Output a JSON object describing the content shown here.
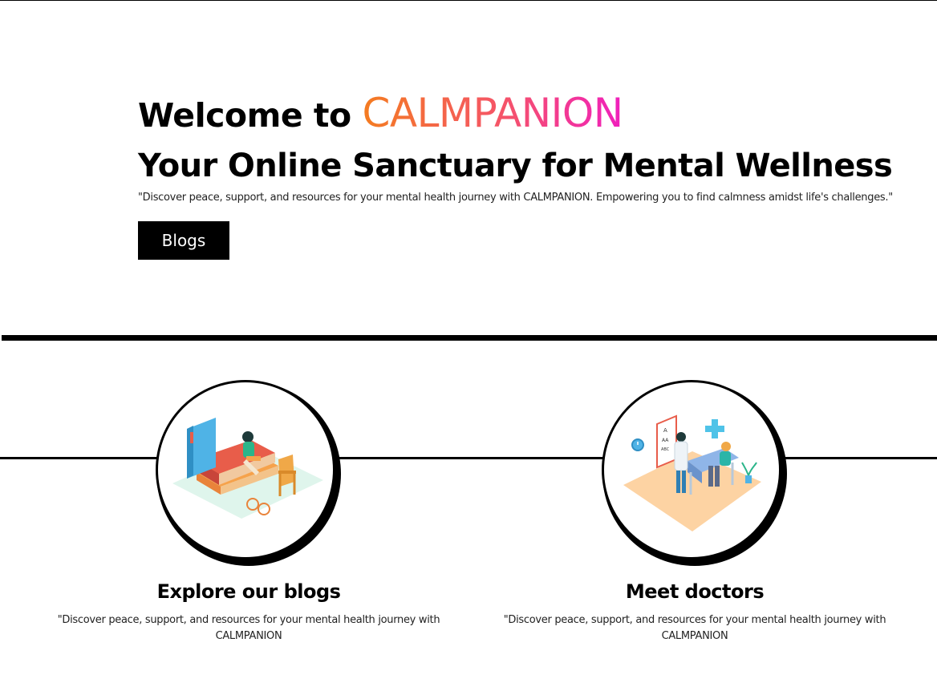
{
  "hero": {
    "welcome_prefix": "Welcome to ",
    "brand": "CALMPANION",
    "subtitle": "Your Online Sanctuary for Mental Wellness",
    "description": "\"Discover peace, support, and resources for your mental health journey with CALMPANION. Empowering you to find calmness amidst life's challenges.\"",
    "button_label": "Blogs"
  },
  "colors": {
    "brand_gradient": [
      "#f47c20",
      "#f5536a",
      "#f01fbd"
    ],
    "button_bg": "#000000",
    "button_text": "#ffffff"
  },
  "features": [
    {
      "icon": "reading-illustration-icon",
      "title": "Explore our blogs",
      "description": "\"Discover peace, support, and resources for your mental health journey with CALMPANION"
    },
    {
      "icon": "doctor-consultation-illustration-icon",
      "title": "Meet doctors",
      "description": "\"Discover peace, support, and resources for your mental health journey with CALMPANION"
    }
  ]
}
